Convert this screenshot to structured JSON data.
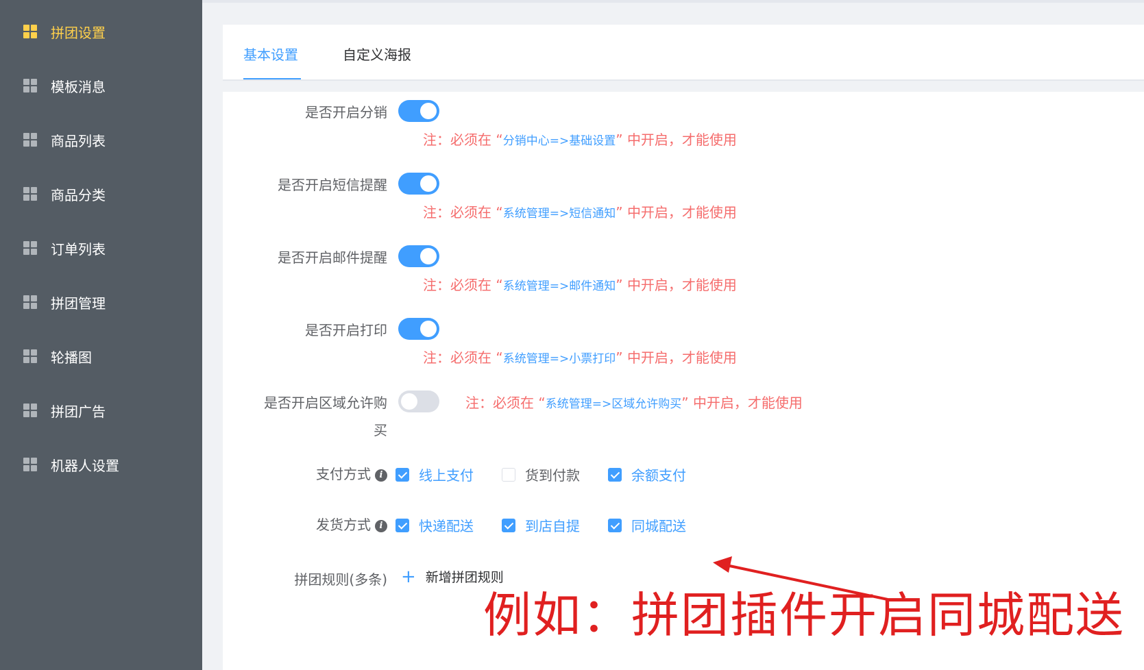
{
  "sidebar": {
    "items": [
      {
        "label": "拼团设置",
        "active": true
      },
      {
        "label": "模板消息"
      },
      {
        "label": "商品列表"
      },
      {
        "label": "商品分类"
      },
      {
        "label": "订单列表"
      },
      {
        "label": "拼团管理"
      },
      {
        "label": "轮播图"
      },
      {
        "label": "拼团广告"
      },
      {
        "label": "机器人设置"
      }
    ]
  },
  "tabs": {
    "basic": "基本设置",
    "poster": "自定义海报"
  },
  "form": {
    "distribution": {
      "label": "是否开启分销",
      "enabled": true,
      "note_prefix": "注：必须在 “",
      "note_path": "分销中心=>基础设置",
      "note_suffix": "” 中开启，才能使用"
    },
    "sms": {
      "label": "是否开启短信提醒",
      "enabled": true,
      "note_prefix": "注：必须在 “",
      "note_path": "系统管理=>短信通知",
      "note_suffix": "” 中开启，才能使用"
    },
    "email": {
      "label": "是否开启邮件提醒",
      "enabled": true,
      "note_prefix": "注：必须在 “",
      "note_path": "系统管理=>邮件通知",
      "note_suffix": "” 中开启，才能使用"
    },
    "print": {
      "label": "是否开启打印",
      "enabled": true,
      "note_prefix": "注：必须在 “",
      "note_path": "系统管理=>小票打印",
      "note_suffix": "” 中开启，才能使用"
    },
    "region": {
      "label_line1": "是否开启区域允许购",
      "label_line2": "买",
      "enabled": false,
      "note_prefix": "注：必须在 “",
      "note_path": "系统管理=>区域允许购买",
      "note_suffix": "” 中开启，才能使用"
    },
    "payment": {
      "label": "支付方式",
      "info_icon": "i",
      "options": [
        {
          "label": "线上支付",
          "checked": true
        },
        {
          "label": "货到付款",
          "checked": false
        },
        {
          "label": "余额支付",
          "checked": true
        }
      ]
    },
    "delivery": {
      "label": "发货方式",
      "info_icon": "i",
      "options": [
        {
          "label": "快递配送",
          "checked": true
        },
        {
          "label": "到店自提",
          "checked": true
        },
        {
          "label": "同城配送",
          "checked": true
        }
      ]
    },
    "rules": {
      "label": "拼团规则(多条)",
      "add_icon": "+",
      "add_label": "新增拼团规则"
    }
  },
  "annotation": {
    "text": "例如：拼团插件开启同城配送",
    "color": "#e02020"
  },
  "colors": {
    "sidebar_bg": "#545c64",
    "active": "#ffd04b",
    "primary": "#409eff",
    "danger": "#f56c6c"
  }
}
